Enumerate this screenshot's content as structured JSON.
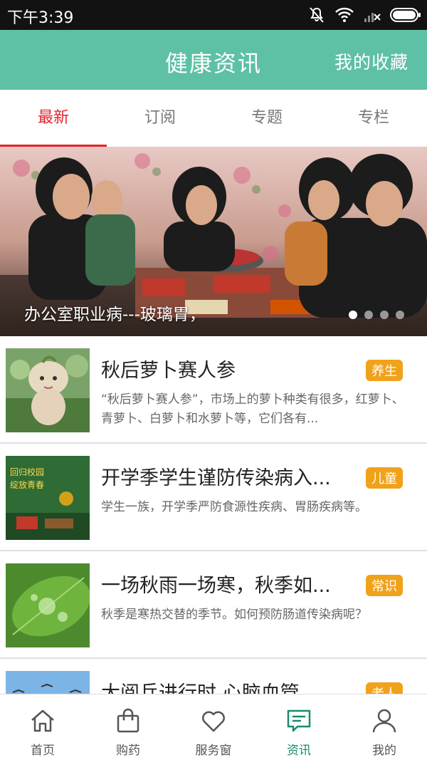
{
  "status_bar": {
    "time": "下午3:39"
  },
  "header": {
    "title": "健康资讯",
    "favorites_label": "我的收藏"
  },
  "tabs": [
    {
      "label": "最新"
    },
    {
      "label": "订阅"
    },
    {
      "label": "专题"
    },
    {
      "label": "专栏"
    }
  ],
  "banner": {
    "caption": "办公室职业病---玻璃胃，",
    "slide_count": 4,
    "active_slide": 1
  },
  "news": [
    {
      "title": "秋后萝卜赛人参",
      "summary": "“秋后萝卜赛人参”，市场上的萝卜种类有很多，红萝卜、青萝卜、白萝卜和水萝卜等，它们各有...",
      "tag": "养生"
    },
    {
      "title": "开学季学生谨防传染病入...",
      "summary": "学生一族，开学季严防食源性疾病、胃肠疾病等。",
      "tag": "儿童",
      "thumb_text_1": "回归校园",
      "thumb_text_2": "绽放青春"
    },
    {
      "title": "一场秋雨一场寒，秋季如...",
      "summary": "秋季是寒热交替的季节。如何预防肠道传染病呢？",
      "tag": "常识"
    },
    {
      "title": "大阅兵进行时 心脑血管...",
      "summary": "",
      "tag": "老人"
    }
  ],
  "bottom_nav": [
    {
      "label": "首页",
      "icon": "home-icon"
    },
    {
      "label": "购药",
      "icon": "shopping-bag-icon"
    },
    {
      "label": "服务窗",
      "icon": "heart-icon"
    },
    {
      "label": "资讯",
      "icon": "news-icon"
    },
    {
      "label": "我的",
      "icon": "person-icon"
    }
  ],
  "colors": {
    "header_bg": "#5ec0a5",
    "tab_active": "#e2252b",
    "tag_bg": "#f0a21b",
    "nav_active": "#1a8a6e"
  }
}
